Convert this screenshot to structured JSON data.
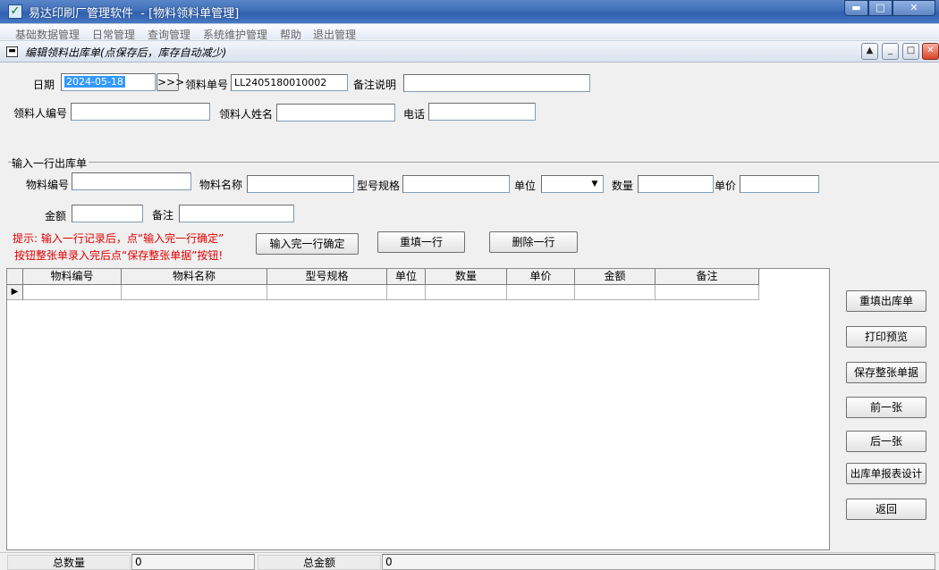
{
  "window": {
    "app_name": "易达印刷厂管理软件",
    "doc_title": "  - [物料领料单管理]",
    "minimize": "▬",
    "maximize": "□",
    "close": "✕"
  },
  "menu": [
    "基础数据管理",
    "日常管理",
    "查询管理",
    "系统维护管理",
    "帮助",
    "退出管理"
  ],
  "child": {
    "title": "编辑领料出库单(点保存后，库存自动减少)"
  },
  "header_form": {
    "date_label": "日期",
    "date_value": "2024-05-18",
    "date_btn": ">>>",
    "order_no_label": "领料单号",
    "order_no_value": "LL2405180010002",
    "remark_label": "备注说明",
    "remark_value": "",
    "picker_no_label": "领料人编号",
    "picker_no_value": "",
    "picker_name_label": "领料人姓名",
    "picker_name_value": "",
    "phone_label": "电话",
    "phone_value": ""
  },
  "line_form": {
    "group_title": "输入一行出库单",
    "code_label": "物料编号",
    "name_label": "物料名称",
    "spec_label": "型号规格",
    "unit_label": "单位",
    "qty_label": "数量",
    "price_label": "单价",
    "amount_label": "金额",
    "note_label": "备注",
    "hint_line1": "提示: 输入一行记录后，点“输入完一行确定”",
    "hint_line2": "按钮整张单录入完后点“保存整张单据”按钮!",
    "confirm_btn": "输入完一行确定",
    "refill_btn": "重填一行",
    "delete_btn": "删除一行"
  },
  "grid": {
    "columns": [
      "物料编号",
      "物料名称",
      "型号规格",
      "单位",
      "数量",
      "单价",
      "金额",
      "备注"
    ],
    "row_indicator": "▶"
  },
  "side_buttons": [
    "重填出库单",
    "打印预览",
    "保存整张单据",
    "前一张",
    "后一张",
    "出库单报表设计",
    "返回"
  ],
  "status": {
    "total_qty_label": "总数量",
    "total_qty_value": "0",
    "total_amount_label": "总金额",
    "total_amount_value": "0"
  }
}
